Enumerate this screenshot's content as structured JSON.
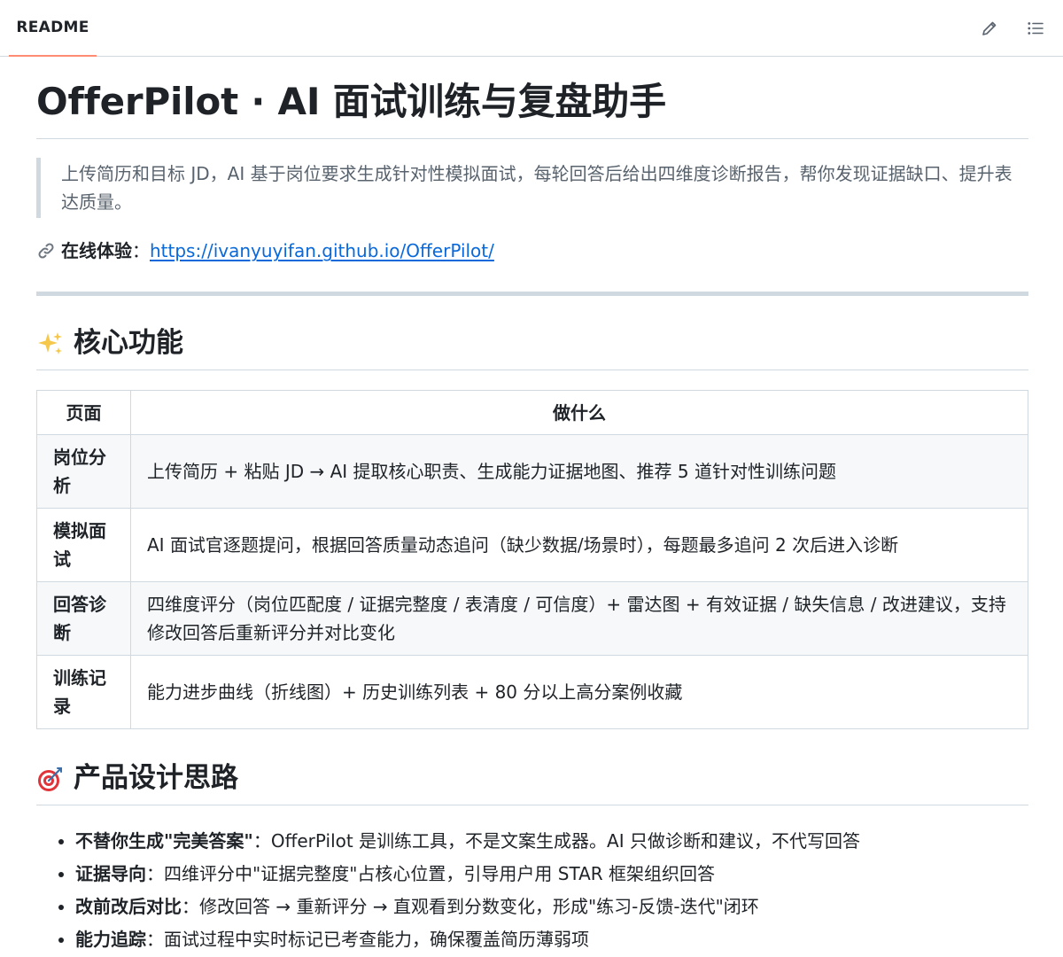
{
  "tab": {
    "label": "README"
  },
  "toolbar": {
    "edit_icon": "pencil-icon",
    "outline_icon": "list-icon"
  },
  "title": "OfferPilot · AI 面试训练与复盘助手",
  "summary": "上传简历和目标 JD，AI 基于岗位要求生成针对性模拟面试，每轮回答后给出四维度诊断报告，帮你发现证据缺口、提升表达质量。",
  "online": {
    "icon": "link-icon",
    "label": "在线体验",
    "sep": "：",
    "url": "https://ivanyuyifan.github.io/OfferPilot/"
  },
  "features": {
    "icon": "sparkles-icon",
    "heading": "核心功能",
    "headers": [
      "页面",
      "做什么"
    ],
    "rows": [
      {
        "page": "岗位分析",
        "desc": "上传简历 + 粘贴 JD → AI 提取核心职责、生成能力证据地图、推荐 5 道针对性训练问题"
      },
      {
        "page": "模拟面试",
        "desc": "AI 面试官逐题提问，根据回答质量动态追问（缺少数据/场景时），每题最多追问 2 次后进入诊断"
      },
      {
        "page": "回答诊断",
        "desc": "四维度评分（岗位匹配度 / 证据完整度 / 表清度 / 可信度）+ 雷达图 + 有效证据 / 缺失信息 / 改进建议，支持修改回答后重新评分并对比变化"
      },
      {
        "page": "训练记录",
        "desc": "能力进步曲线（折线图）+ 历史训练列表 + 80 分以上高分案例收藏"
      }
    ]
  },
  "design": {
    "icon": "target-icon",
    "heading": "产品设计思路",
    "items": [
      {
        "bold": "不替你生成\"完美答案\"",
        "sep": "：",
        "text": "OfferPilot 是训练工具，不是文案生成器。AI 只做诊断和建议，不代写回答"
      },
      {
        "bold": "证据导向",
        "sep": "：",
        "text": "四维评分中\"证据完整度\"占核心位置，引导用户用 STAR 框架组织回答"
      },
      {
        "bold": "改前改后对比",
        "sep": "：",
        "text": "修改回答 → 重新评分 → 直观看到分数变化，形成\"练习-反馈-迭代\"闭环"
      },
      {
        "bold": "能力追踪",
        "sep": "：",
        "text": "面试过程中实时标记已考查能力，确保覆盖简历薄弱项"
      }
    ]
  }
}
